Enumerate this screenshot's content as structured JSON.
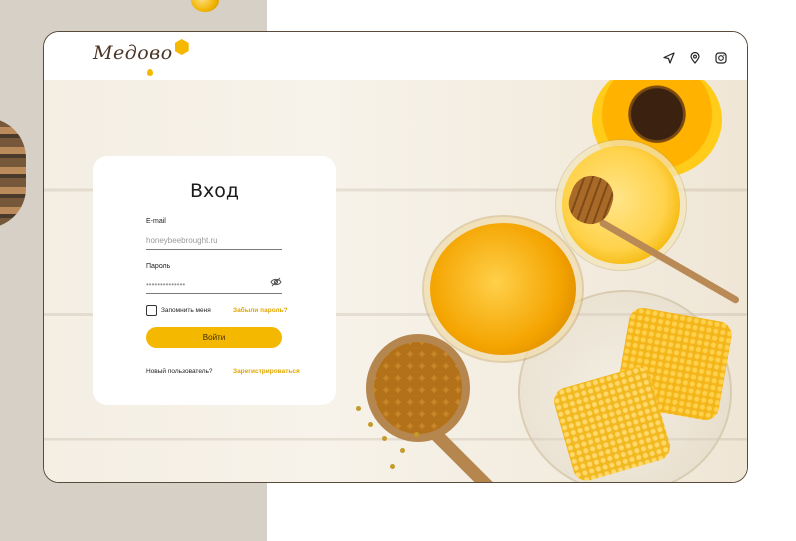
{
  "brand": {
    "logo_text": "Медово"
  },
  "nav": {
    "icons": [
      "send-icon",
      "location-pin-icon",
      "instagram-icon"
    ]
  },
  "login": {
    "title": "Вход",
    "email_label": "E-mail",
    "email_placeholder": "honeybeebrought.ru",
    "password_label": "Пароль",
    "password_value": "••••••••••••••",
    "remember_label": "Запомнить меня",
    "forgot_link": "Забыли пароль?",
    "submit_label": "Войти",
    "new_user_text": "Новый пользователь?",
    "register_link": "Зарегистрироваться"
  },
  "colors": {
    "accent": "#f5b800",
    "link": "#e0a800",
    "side_panel": "#d6d0c6",
    "frame_border": "#5a4a3a"
  }
}
